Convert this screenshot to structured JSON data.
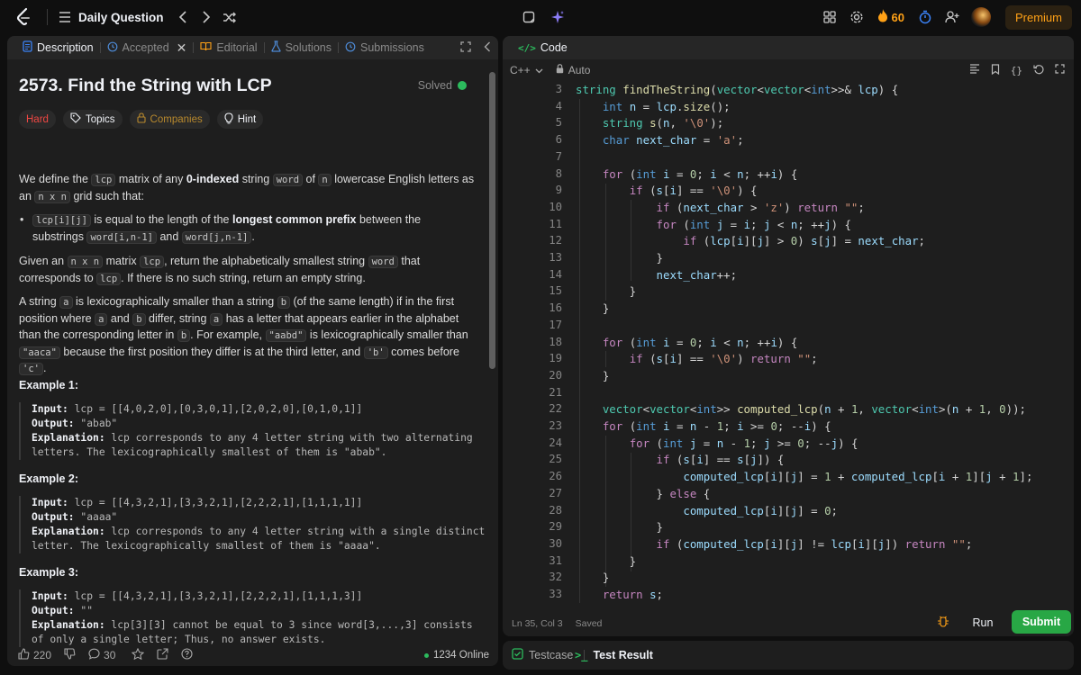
{
  "topbar": {
    "title": "Daily Question",
    "streak": "60",
    "premium": "Premium"
  },
  "left_tabs": [
    {
      "label": "Description",
      "active": true
    },
    {
      "label": "Accepted",
      "active": false
    },
    {
      "label": "Editorial",
      "active": false
    },
    {
      "label": "Solutions",
      "active": false
    },
    {
      "label": "Submissions",
      "active": false
    }
  ],
  "problem": {
    "title": "2573. Find the String with LCP",
    "status": "Solved",
    "difficulty": "Hard",
    "topics": "Topics",
    "companies": "Companies",
    "hint": "Hint"
  },
  "statement": {
    "p1_a": "We define the ",
    "p1_code1": "lcp",
    "p1_b": " matrix of any ",
    "p1_bold": "0-indexed",
    "p1_c": " string ",
    "p1_code2": "word",
    "p1_d": " of ",
    "p1_code3": "n",
    "p1_e": " lowercase English letters as an ",
    "p1_code4": "n x n",
    "p1_f": " grid such that:",
    "b1_code1": "lcp[i][j]",
    "b1_a": " is equal to the length of the ",
    "b1_bold": "longest common prefix",
    "b1_b": " between the substrings ",
    "b1_code2": "word[i,n-1]",
    "b1_c": " and ",
    "b1_code3": "word[j,n-1]",
    "b1_d": ".",
    "p2_a": "Given an ",
    "p2_code1": "n x n",
    "p2_b": " matrix ",
    "p2_code2": "lcp",
    "p2_c": ", return the alphabetically smallest string ",
    "p2_code3": "word",
    "p2_d": " that corresponds to ",
    "p2_code4": "lcp",
    "p2_e": ". If there is no such string, return an empty string.",
    "p3_a": "A string ",
    "p3_code1": "a",
    "p3_b": " is lexicographically smaller than a string ",
    "p3_code2": "b",
    "p3_c": " (of the same length) if in the first position where ",
    "p3_code3": "a",
    "p3_d": " and ",
    "p3_code4": "b",
    "p3_e": " differ, string ",
    "p3_code5": "a",
    "p3_f": " has a letter that appears earlier in the alphabet than the corresponding letter in ",
    "p3_code6": "b",
    "p3_g": ". For example, ",
    "p3_code7": "\"aabd\"",
    "p3_h": " is lexicographically smaller than ",
    "p3_code8": "\"aaca\"",
    "p3_i": " because the first position they differ is at the third letter, and ",
    "p3_code9": "'b'",
    "p3_j": " comes before ",
    "p3_code10": "'c'",
    "p3_k": "."
  },
  "examples": [
    {
      "title": "Example 1:",
      "input_label": "Input:",
      "input": " lcp = [[4,0,2,0],[0,3,0,1],[2,0,2,0],[0,1,0,1]]",
      "output_label": "Output:",
      "output": " \"abab\"",
      "expl_label": "Explanation:",
      "expl1": " lcp corresponds to any 4 letter string with two alternating",
      "expl2": "letters. The lexicographically smallest of them is \"abab\"."
    },
    {
      "title": "Example 2:",
      "input_label": "Input:",
      "input": " lcp = [[4,3,2,1],[3,3,2,1],[2,2,2,1],[1,1,1,1]]",
      "output_label": "Output:",
      "output": " \"aaaa\"",
      "expl_label": "Explanation:",
      "expl1": " lcp corresponds to any 4 letter string with a single distinct",
      "expl2": "letter. The lexicographically smallest of them is \"aaaa\"."
    },
    {
      "title": "Example 3:",
      "input_label": "Input:",
      "input": " lcp = [[4,3,2,1],[3,3,2,1],[2,2,2,1],[1,1,1,3]]",
      "output_label": "Output:",
      "output": " \"\"",
      "expl_label": "Explanation:",
      "expl1": " lcp[3][3] cannot be equal to 3 since word[3,...,3] consists",
      "expl2": "of only a single letter; Thus, no answer exists."
    }
  ],
  "left_footer": {
    "likes": "220",
    "comments": "30",
    "online": "1234 Online"
  },
  "code_panel": {
    "tab": "Code",
    "language": "C++",
    "autosave": "Auto",
    "cursor": "Ln 35, Col 3",
    "saved": "Saved",
    "run": "Run",
    "submit": "Submit"
  },
  "code_lines": [
    {
      "n": "3"
    },
    {
      "n": "4"
    },
    {
      "n": "5"
    },
    {
      "n": "6"
    },
    {
      "n": "7"
    },
    {
      "n": "8"
    },
    {
      "n": "9"
    },
    {
      "n": "10"
    },
    {
      "n": "11"
    },
    {
      "n": "12"
    },
    {
      "n": "13"
    },
    {
      "n": "14"
    },
    {
      "n": "15"
    },
    {
      "n": "16"
    },
    {
      "n": "17"
    },
    {
      "n": "18"
    },
    {
      "n": "19"
    },
    {
      "n": "20"
    },
    {
      "n": "21"
    },
    {
      "n": "22"
    },
    {
      "n": "23"
    },
    {
      "n": "24"
    },
    {
      "n": "25"
    },
    {
      "n": "26"
    },
    {
      "n": "27"
    },
    {
      "n": "28"
    },
    {
      "n": "29"
    },
    {
      "n": "30"
    },
    {
      "n": "31"
    },
    {
      "n": "32"
    },
    {
      "n": "33"
    }
  ],
  "bottom_tabs": {
    "testcase": "Testcase",
    "test_result": "Test Result"
  },
  "colors": {
    "accent": "#ffa116",
    "submit": "#28a745",
    "hard": "#ef4743",
    "solved": "#2cbb5d"
  }
}
